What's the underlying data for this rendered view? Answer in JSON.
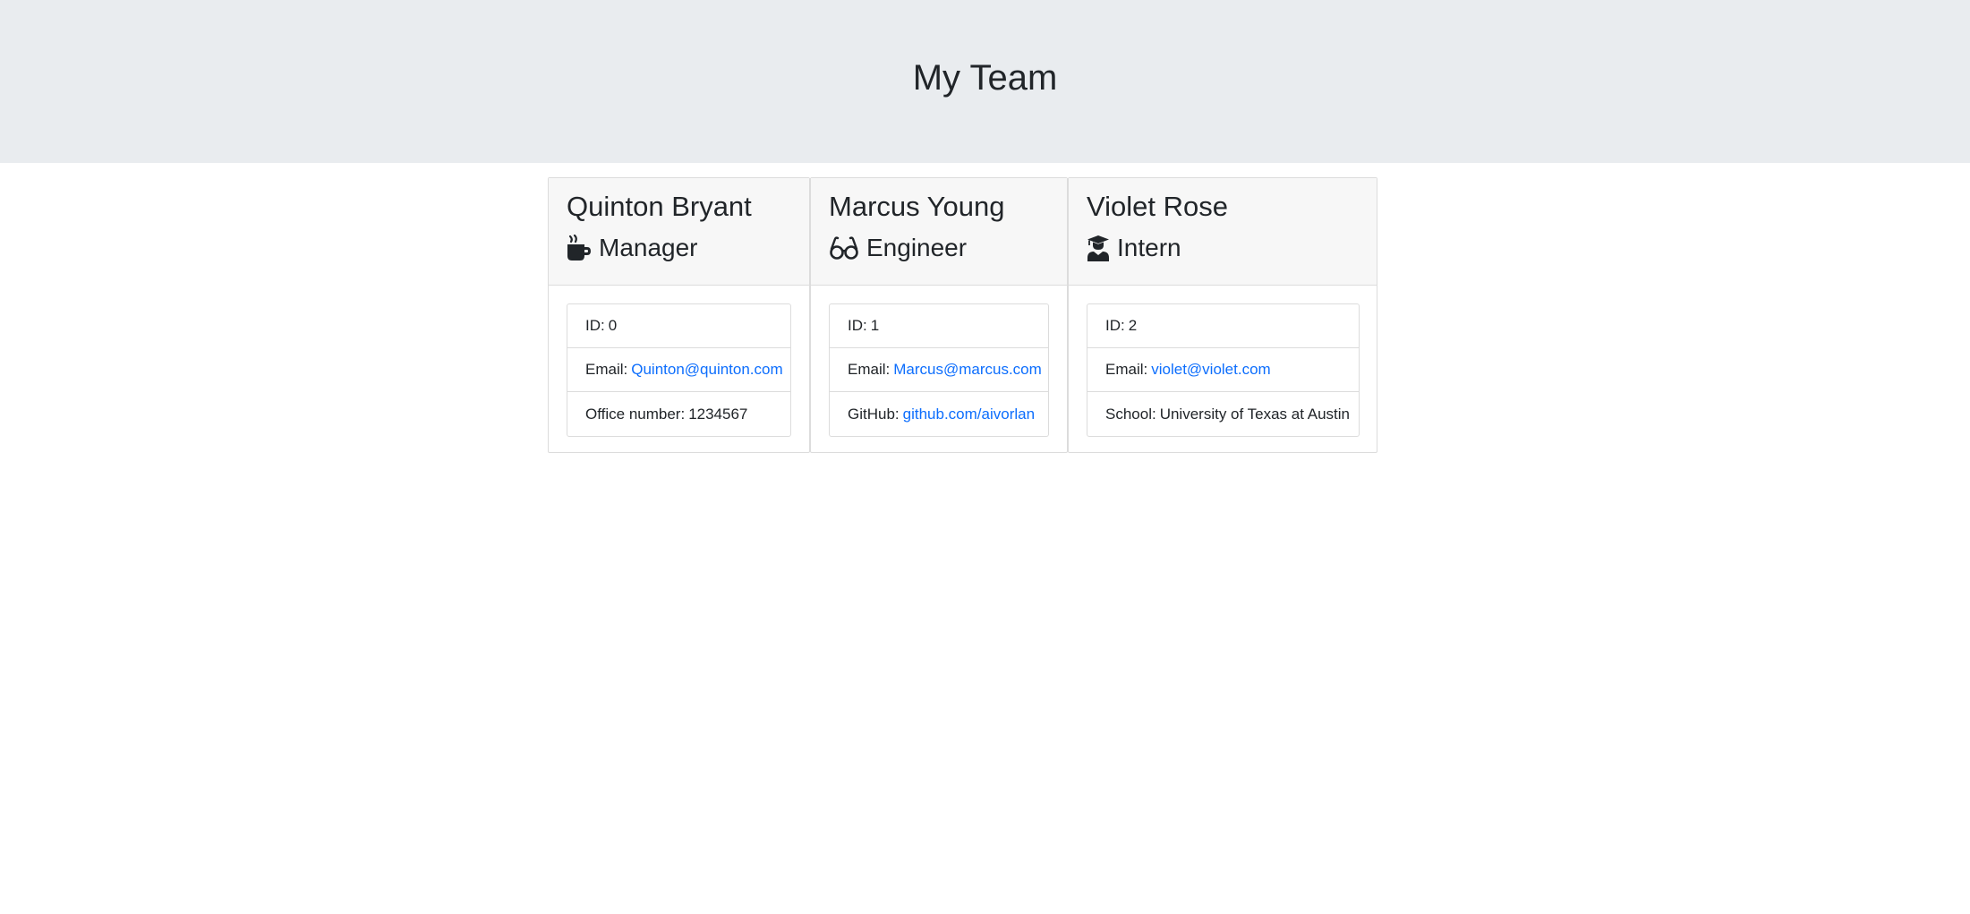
{
  "header": {
    "title": "My Team"
  },
  "team": [
    {
      "name": "Quinton Bryant",
      "role": "Manager",
      "icon": "mug-icon",
      "id_label": "ID:",
      "id": "0",
      "email_label": "Email:",
      "email": "Quinton@quinton.com",
      "extra_label": "Office number:",
      "extra_value": "1234567"
    },
    {
      "name": "Marcus Young",
      "role": "Engineer",
      "icon": "glasses-icon",
      "id_label": "ID:",
      "id": "1",
      "email_label": "Email:",
      "email": "Marcus@marcus.com",
      "extra_label": "GitHub:",
      "extra_value": "github.com/aivorlan"
    },
    {
      "name": "Violet Rose",
      "role": "Intern",
      "icon": "graduate-icon",
      "id_label": "ID:",
      "id": "2",
      "email_label": "Email:",
      "email": "violet@violet.com",
      "extra_label": "School:",
      "extra_value": "University of Texas at Austin"
    }
  ],
  "colors": {
    "jumbotron_bg": "#e9ecef",
    "card_header_bg": "#f7f7f7",
    "link": "#0d6efd",
    "text": "#212529"
  }
}
